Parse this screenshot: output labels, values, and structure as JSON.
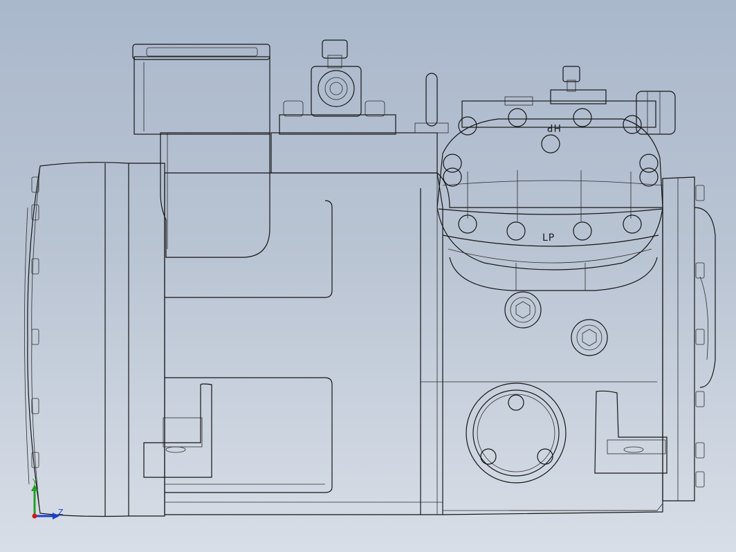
{
  "viewport": {
    "background_top": "#aab8cc",
    "background_bottom": "#d8dee7",
    "model_shade": "#a9a9a9"
  },
  "labels": {
    "high_pressure": "HP",
    "low_pressure": "LP"
  },
  "triad": {
    "y_label": "Y",
    "z_label": "Z",
    "y_color": "#22a022",
    "z_color": "#1a3fd0",
    "origin_color": "#d01818"
  }
}
